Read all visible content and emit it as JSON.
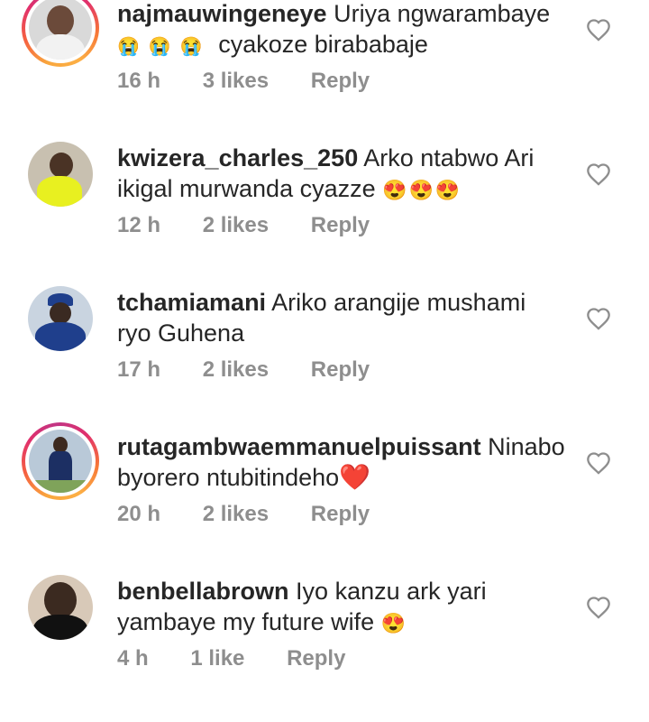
{
  "comments": [
    {
      "username": "najmauwingeneye",
      "line1": "Uriya ngwarambaye",
      "line2_emoji": "😭😭😭",
      "line2_text": "cyakoze birababaje",
      "time": "16 h",
      "likes": "3 likes",
      "reply": "Reply",
      "avatar": {
        "ring": true,
        "bg": "#d9d9d9",
        "skin": "#6b4a3a",
        "shirt": "#f2f2f2"
      }
    },
    {
      "username": "kwizera_charles_250",
      "line1": "Arko ntabwo Ari",
      "line2_text": "ikigal murwanda cyazze",
      "line2_emoji": "😍😍😍",
      "time": "12 h",
      "likes": "2 likes",
      "reply": "Reply",
      "avatar": {
        "ring": false,
        "bg": "#c8c0b0",
        "skin": "#4a3325",
        "shirt": "#e8f020"
      }
    },
    {
      "username": "tchamiamani",
      "line1": "Ariko arangije mushami",
      "line2_text": "ryo Guhena",
      "time": "17 h",
      "likes": "2 likes",
      "reply": "Reply",
      "avatar": {
        "ring": false,
        "bg": "#c9d4e0",
        "skin": "#3a2a22",
        "shirt": "#1f3f8c"
      }
    },
    {
      "username": "rutagambwaemmanuelpuissant",
      "line1": "Ninabo",
      "line2_text": "byorero ntubitindeho",
      "line2_emoji": "❤️",
      "time": "20 h",
      "likes": "2 likes",
      "reply": "Reply",
      "avatar": {
        "ring": true,
        "bg": "#b9c9d8",
        "skin": "#3d2a20",
        "shirt": "#1c2f63"
      }
    },
    {
      "username": "benbellabrown",
      "line1": "Iyo kanzu ark yari",
      "line2_text": "yambaye my future wife",
      "line2_emoji": "😍",
      "time": "4 h",
      "likes": "1 like",
      "reply": "Reply",
      "avatar": {
        "ring": false,
        "bg": "#d8c9b8",
        "skin": "#3b2a20",
        "shirt": "#111111"
      }
    }
  ],
  "icons": {
    "like": "heart-outline-icon"
  }
}
